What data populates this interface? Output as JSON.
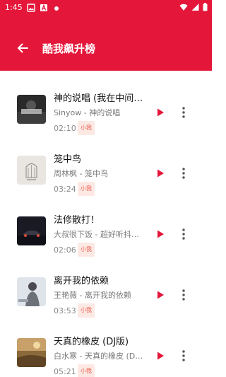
{
  "colors": {
    "brand": "#e4163a",
    "badge_bg": "#fde9e4",
    "badge_text": "#e85b4b",
    "play": "#e4163a"
  },
  "status": {
    "time": "1:45"
  },
  "header": {
    "title": "酷我飙升榜"
  },
  "songs": [
    {
      "title": "神的说唱 (我在中间…",
      "subtitle": "Sinyow - 神的说唱",
      "duration": "02:10",
      "badge": "小我"
    },
    {
      "title": "笼中鸟",
      "subtitle": "周林枫 - 笼中鸟",
      "duration": "03:24",
      "badge": "小我"
    },
    {
      "title": "法修散打！",
      "subtitle": "大叔很下饭 - 超好听抖…",
      "duration": "02:06",
      "badge": "小我"
    },
    {
      "title": "离开我的依赖",
      "subtitle": "王艳薇 - 离开我的依赖",
      "duration": "03:53",
      "badge": "小我"
    },
    {
      "title": "天真的橡皮 (DJ版)",
      "subtitle": "白水寒 - 天真的橡皮 (D…",
      "duration": "05:21",
      "badge": "小我"
    }
  ]
}
